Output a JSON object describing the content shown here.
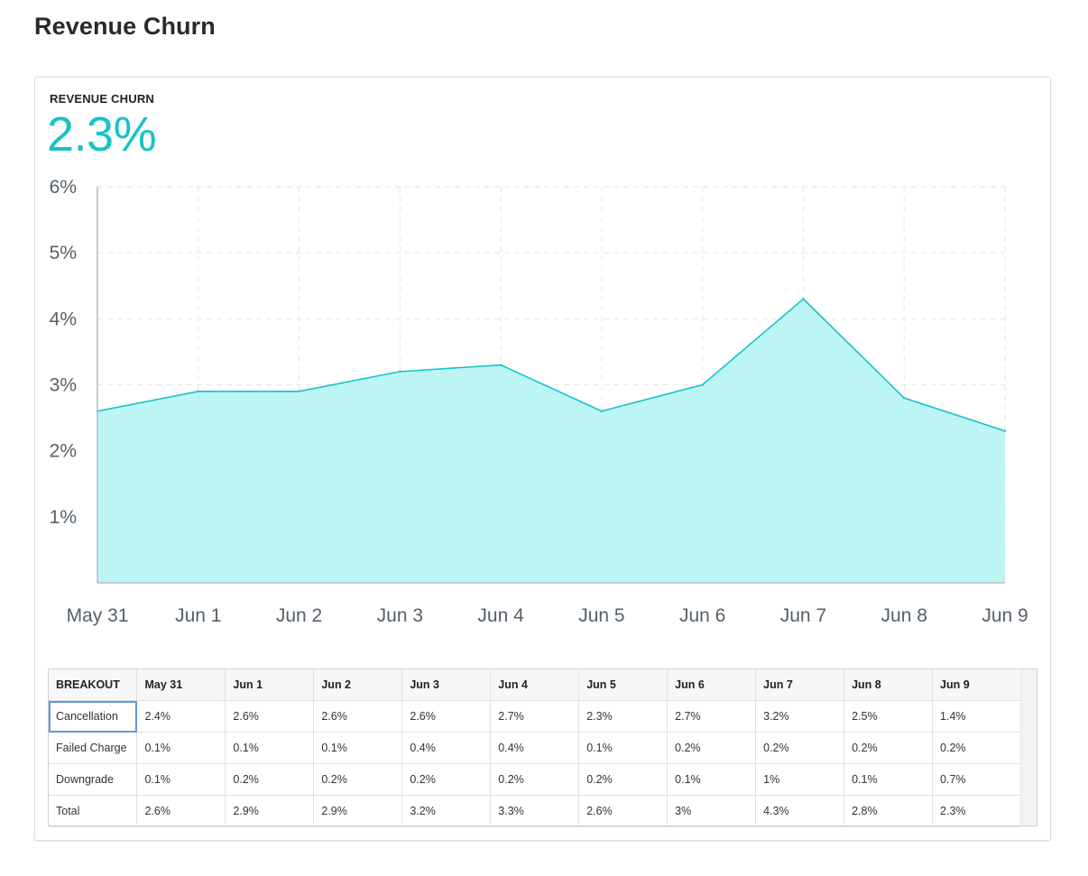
{
  "page": {
    "title": "Revenue Churn"
  },
  "card": {
    "metric_label": "REVENUE CHURN",
    "metric_value": "2.3%"
  },
  "colors": {
    "accent": "#17c3c6",
    "area_fill": "#bdf5f5",
    "grid": "#e6e6e6",
    "axis": "#b0bcc4",
    "tick_text": "#55606a"
  },
  "chart_data": {
    "type": "area",
    "categories": [
      "May 31",
      "Jun 1",
      "Jun 2",
      "Jun 3",
      "Jun 4",
      "Jun 5",
      "Jun 6",
      "Jun 7",
      "Jun 8",
      "Jun 9"
    ],
    "series": [
      {
        "values": [
          2.6,
          2.9,
          2.9,
          3.2,
          3.3,
          2.6,
          3.0,
          4.3,
          2.8,
          2.3
        ]
      }
    ],
    "ylim": [
      0,
      6
    ],
    "yticks": [
      1,
      2,
      3,
      4,
      5,
      6
    ],
    "ytick_labels": [
      "1%",
      "2%",
      "3%",
      "4%",
      "5%",
      "6%"
    ],
    "grid": true,
    "xlabel": "",
    "ylabel": ""
  },
  "breakout": {
    "header_label": "BREAKOUT",
    "columns": [
      "May 31",
      "Jun 1",
      "Jun 2",
      "Jun 3",
      "Jun 4",
      "Jun 5",
      "Jun 6",
      "Jun 7",
      "Jun 8",
      "Jun 9"
    ],
    "rows": [
      {
        "label": "Cancellation",
        "values": [
          "2.4%",
          "2.6%",
          "2.6%",
          "2.6%",
          "2.7%",
          "2.3%",
          "2.7%",
          "3.2%",
          "2.5%",
          "1.4%"
        ]
      },
      {
        "label": "Failed Charge",
        "values": [
          "0.1%",
          "0.1%",
          "0.1%",
          "0.4%",
          "0.4%",
          "0.1%",
          "0.2%",
          "0.2%",
          "0.2%",
          "0.2%"
        ]
      },
      {
        "label": "Downgrade",
        "values": [
          "0.1%",
          "0.2%",
          "0.2%",
          "0.2%",
          "0.2%",
          "0.2%",
          "0.1%",
          "1%",
          "0.1%",
          "0.7%"
        ]
      },
      {
        "label": "Total",
        "values": [
          "2.6%",
          "2.9%",
          "2.9%",
          "3.2%",
          "3.3%",
          "2.6%",
          "3%",
          "4.3%",
          "2.8%",
          "2.3%"
        ]
      }
    ]
  }
}
